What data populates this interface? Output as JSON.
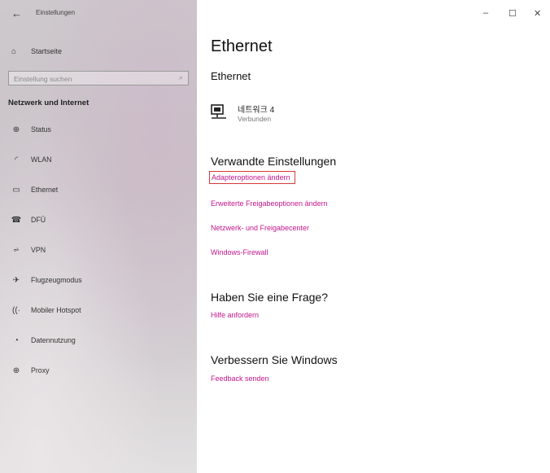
{
  "window": {
    "title": "Einstellungen",
    "controls": {
      "minimize": "–",
      "maximize": "☐",
      "close": "✕"
    }
  },
  "sidebar": {
    "home_label": "Startseite",
    "search_placeholder": "Einstellung suchen",
    "section_title": "Netzwerk und Internet",
    "items": [
      {
        "label": "Status",
        "icon": "globe-icon"
      },
      {
        "label": "WLAN",
        "icon": "wifi-icon"
      },
      {
        "label": "Ethernet",
        "icon": "ethernet-icon"
      },
      {
        "label": "DFÜ",
        "icon": "phone-icon"
      },
      {
        "label": "VPN",
        "icon": "vpn-icon"
      },
      {
        "label": "Flugzeugmodus",
        "icon": "airplane-icon"
      },
      {
        "label": "Mobiler Hotspot",
        "icon": "hotspot-icon"
      },
      {
        "label": "Datennutzung",
        "icon": "data-usage-icon"
      },
      {
        "label": "Proxy",
        "icon": "globe-icon"
      }
    ]
  },
  "main": {
    "title": "Ethernet",
    "subtitle": "Ethernet",
    "network": {
      "name": "네트워크 4",
      "status": "Verbunden"
    },
    "related": {
      "heading": "Verwandte Einstellungen",
      "links": [
        "Adapteroptionen ändern",
        "Erweiterte Freigabeoptionen ändern",
        "Netzwerk- und Freigabecenter",
        "Windows-Firewall"
      ]
    },
    "question": {
      "heading": "Haben Sie eine Frage?",
      "link": "Hilfe anfordern"
    },
    "improve": {
      "heading": "Verbessern Sie Windows",
      "link": "Feedback senden"
    }
  },
  "colors": {
    "link": "#c2168b",
    "highlight_box": "#d73a3a"
  }
}
